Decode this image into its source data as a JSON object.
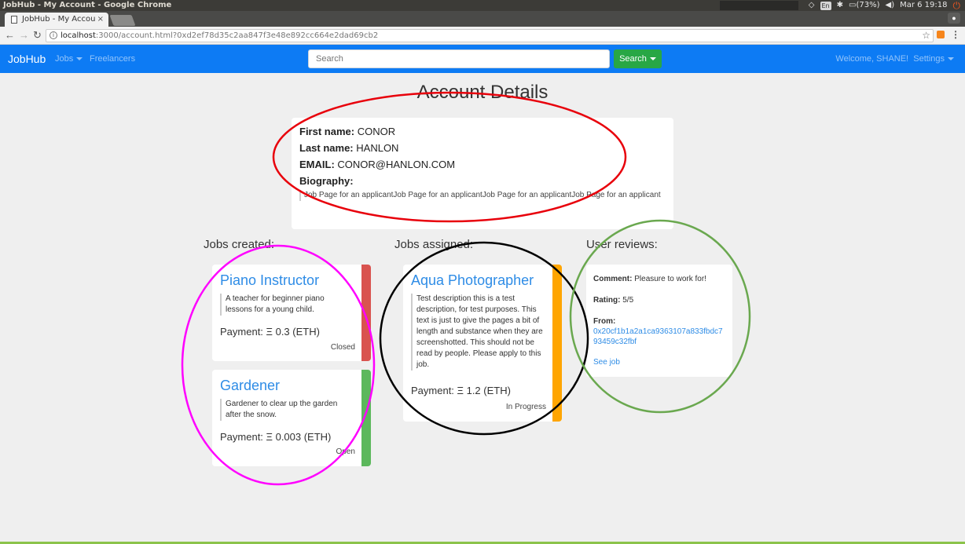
{
  "os": {
    "window_title": "JobHub - My Account - Google Chrome",
    "kbd_layout": "En",
    "battery": "(73%)",
    "clock": "Mar 6 19:18"
  },
  "browser": {
    "tab_title": "JobHub - My Accou",
    "url_host": "localhost",
    "url_rest": ":3000/account.html?0xd2ef78d35c2aa847f3e48e892cc664e2dad69cb2"
  },
  "navbar": {
    "brand": "JobHub",
    "jobs_label": "Jobs",
    "freelancers_label": "Freelancers",
    "search_placeholder": "Search",
    "search_button": "Search",
    "welcome": "Welcome, SHANE!",
    "settings_label": "Settings"
  },
  "account": {
    "title": "Account Details",
    "first_name_label": "First name:",
    "first_name": "CONOR",
    "last_name_label": "Last name:",
    "last_name": "HANLON",
    "email_label": "EMAIL:",
    "email": "CONOR@HANLON.COM",
    "bio_label": "Biography:",
    "bio": "Job Page for an applicantJob Page for an applicantJob Page for an applicantJob Page for an applicant"
  },
  "sections": {
    "created": "Jobs created:",
    "assigned": "Jobs assigned:",
    "reviews": "User reviews:"
  },
  "jobs_created": [
    {
      "title": "Piano Instructor",
      "description": "A teacher for beginner piano lessons for a young child.",
      "payment": "Payment: Ξ 0.3 (ETH)",
      "status": "Closed",
      "status_color": "#d9534f"
    },
    {
      "title": "Gardener",
      "description": "Gardener to clear up the garden after the snow.",
      "payment": "Payment: Ξ 0.003 (ETH)",
      "status": "Open",
      "status_color": "#5cb85c"
    }
  ],
  "jobs_assigned": [
    {
      "title": "Aqua Photographer",
      "description": "Test description this is a test description, for test purposes. This text is just to give the pages a bit of length and substance when they are screenshotted. This should not be read by people. Please apply to this job.",
      "payment": "Payment: Ξ 1.2 (ETH)",
      "status": "In Progress",
      "status_color": "#ffa500"
    }
  ],
  "review": {
    "comment_label": "Comment:",
    "comment": "Pleasure to work for!",
    "rating_label": "Rating:",
    "rating": "5/5",
    "from_label": "From:",
    "from_address": "0x20cf1b1a2a1ca9363107a833fbdc793459c32fbf",
    "see_job": "See job"
  },
  "colors": {
    "navbar": "#0d7bf4",
    "search_button": "#28a745",
    "annotation_red": "#e8000b",
    "annotation_magenta": "#ff00ff",
    "annotation_black": "#000000",
    "annotation_green": "#6aa84f"
  }
}
